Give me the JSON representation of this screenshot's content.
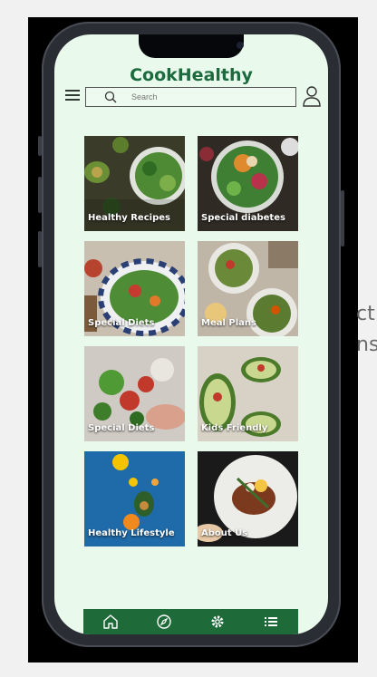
{
  "background_text": [
    "ct",
    "ns"
  ],
  "app": {
    "title": "CookHealthy"
  },
  "search": {
    "placeholder": "Search"
  },
  "tiles": [
    {
      "label": "Healthy Recipes"
    },
    {
      "label": "Special diabetes"
    },
    {
      "label": "Special Diets"
    },
    {
      "label": "Meal Plans"
    },
    {
      "label": "Special Diets"
    },
    {
      "label": "Kids Friendly"
    },
    {
      "label": "Healthy Lifestyle"
    },
    {
      "label": "About Us"
    }
  ],
  "bottom_nav": {
    "icons": [
      "home-icon",
      "compass-icon",
      "settings-icon",
      "list-icon"
    ]
  },
  "colors": {
    "brand": "#1b6b3e",
    "nav": "#1e6b39",
    "screen_bg": "#e9f9ec"
  }
}
